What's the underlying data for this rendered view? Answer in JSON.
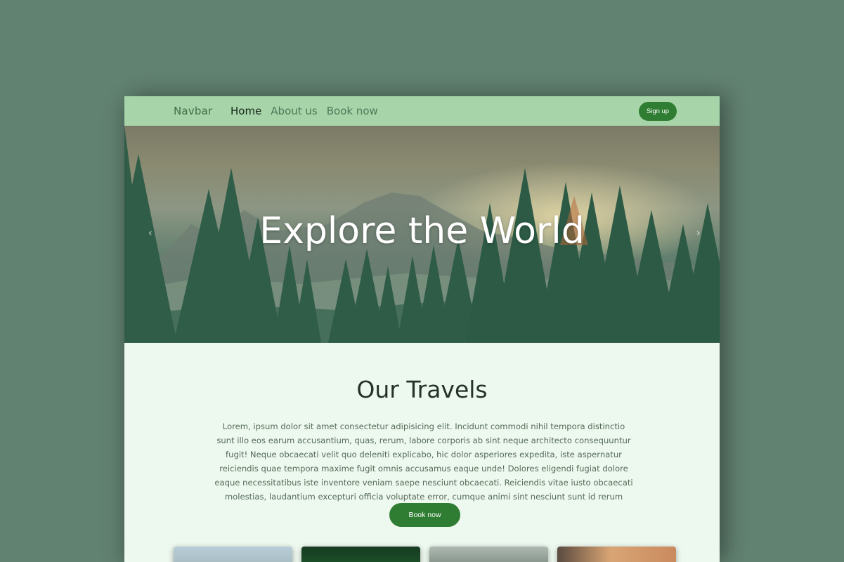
{
  "navbar": {
    "brand": "Navbar",
    "links": [
      {
        "label": "Home",
        "active": true
      },
      {
        "label": "About us",
        "active": false
      },
      {
        "label": "Book now",
        "active": false
      }
    ],
    "signup_label": "Sign up"
  },
  "hero": {
    "title": "Explore the World",
    "prev_icon": "chevron-left-icon",
    "next_icon": "chevron-right-icon"
  },
  "content": {
    "title": "Our Travels",
    "text": "Lorem, ipsum dolor sit amet consectetur adipisicing elit. Incidunt commodi nihil tempora distinctio sunt illo eos earum accusantium, quas, rerum, labore corporis ab sint neque architecto consequuntur fugit! Neque obcaecati velit quo deleniti explicabo, hic dolor asperiores expedita, iste aspernatur reiciendis quae tempora maxime fugit omnis accusamus eaque unde! Dolores eligendi fugiat dolore eaque necessitatibus iste inventore veniam saepe nesciunt obcaecati. Reiciendis vitae iusto obcaecati molestias, laudantium excepturi officia voluptate error, cumque animi sint nesciunt sunt id rerum ratione eaque!",
    "button_label": "Book now"
  },
  "colors": {
    "background": "#628271",
    "navbar": "#a7d4a8",
    "accent": "#2f7d32",
    "page": "#edf8ee"
  }
}
